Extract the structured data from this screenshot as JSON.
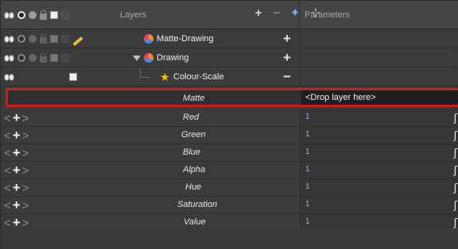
{
  "header": {
    "layers_label": "Layers",
    "parameters_label": "Parameters",
    "tools": [
      "add-layer-icon",
      "add-drawing-icon",
      "add-peg-icon"
    ]
  },
  "layers": [
    {
      "name": "Matte-Drawing",
      "icon": "drawing-layer-icon",
      "action": "+"
    },
    {
      "name": "Drawing",
      "icon": "drawing-layer-icon",
      "action": "+"
    },
    {
      "name": "Colour-Scale",
      "icon": "effect-star-icon",
      "action": "−"
    }
  ],
  "matte": {
    "label": "Matte",
    "value": "<Drop layer here>"
  },
  "params": [
    {
      "label": "Red",
      "value": "1"
    },
    {
      "label": "Green",
      "value": "1"
    },
    {
      "label": "Blue",
      "value": "1"
    },
    {
      "label": "Alpha",
      "value": "1"
    },
    {
      "label": "Hue",
      "value": "1"
    },
    {
      "label": "Saturation",
      "value": "1"
    },
    {
      "label": "Value",
      "value": "1"
    }
  ],
  "glyphs": {
    "prev": "<",
    "next": ">",
    "add_key": "+",
    "function": "ʃ"
  },
  "colors": {
    "highlight_border": "#d01b1b",
    "value_text": "#7fb6ff"
  }
}
